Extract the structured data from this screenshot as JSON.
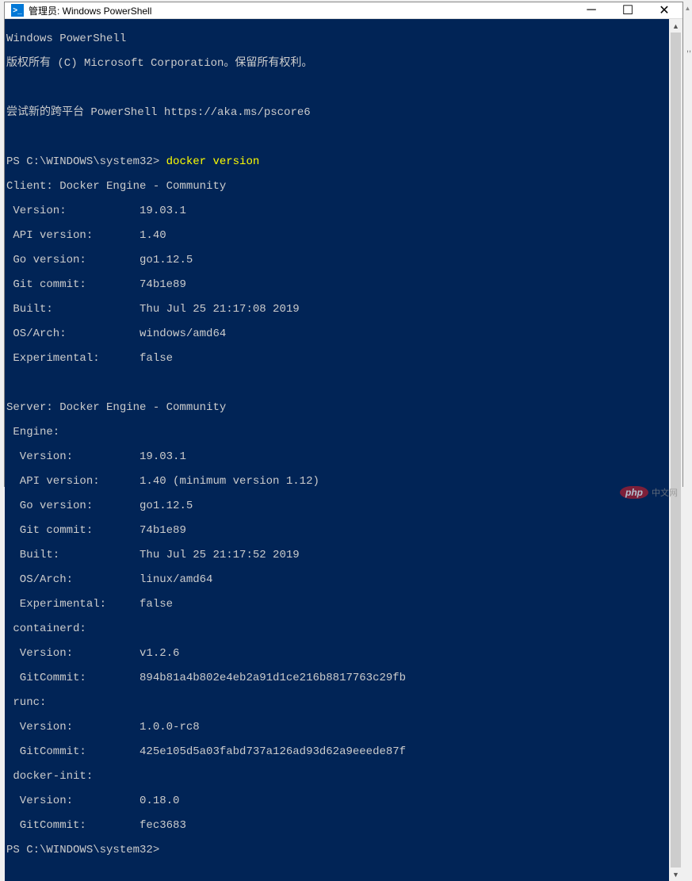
{
  "window": {
    "title": "管理员: Windows PowerShell",
    "icon_glyph": ">_"
  },
  "controls": {
    "minimize": "─",
    "maximize": "☐",
    "close": "✕"
  },
  "scrollbar": {
    "up": "▲",
    "down": "▼"
  },
  "header": {
    "line1": "Windows PowerShell",
    "line2": "版权所有 (C) Microsoft Corporation。保留所有权利。",
    "line3": "尝试新的跨平台 PowerShell https://aka.ms/pscore6"
  },
  "prompt1": {
    "prefix": "PS C:\\WINDOWS\\system32> ",
    "command": "docker version"
  },
  "output": {
    "client_header": "Client: Docker Engine - Community",
    "client": {
      "version_label": " Version:           ",
      "version_val": "19.03.1",
      "api_label": " API version:       ",
      "api_val": "1.40",
      "go_label": " Go version:        ",
      "go_val": "go1.12.5",
      "git_label": " Git commit:        ",
      "git_val": "74b1e89",
      "built_label": " Built:             ",
      "built_val": "Thu Jul 25 21:17:08 2019",
      "os_label": " OS/Arch:           ",
      "os_val": "windows/amd64",
      "exp_label": " Experimental:      ",
      "exp_val": "false"
    },
    "server_header": "Server: Docker Engine - Community",
    "engine_header": " Engine:",
    "engine": {
      "version_label": "  Version:          ",
      "version_val": "19.03.1",
      "api_label": "  API version:      ",
      "api_val": "1.40 (minimum version 1.12)",
      "go_label": "  Go version:       ",
      "go_val": "go1.12.5",
      "git_label": "  Git commit:       ",
      "git_val": "74b1e89",
      "built_label": "  Built:            ",
      "built_val": "Thu Jul 25 21:17:52 2019",
      "os_label": "  OS/Arch:          ",
      "os_val": "linux/amd64",
      "exp_label": "  Experimental:     ",
      "exp_val": "false"
    },
    "containerd_header": " containerd:",
    "containerd": {
      "version_label": "  Version:          ",
      "version_val": "v1.2.6",
      "git_label": "  GitCommit:        ",
      "git_val": "894b81a4b802e4eb2a91d1ce216b8817763c29fb"
    },
    "runc_header": " runc:",
    "runc": {
      "version_label": "  Version:          ",
      "version_val": "1.0.0-rc8",
      "git_label": "  GitCommit:        ",
      "git_val": "425e105d5a03fabd737a126ad93d62a9eeede87f"
    },
    "dockerinit_header": " docker-init:",
    "dockerinit": {
      "version_label": "  Version:          ",
      "version_val": "0.18.0",
      "git_label": "  GitCommit:        ",
      "git_val": "fec3683"
    }
  },
  "prompt2": "PS C:\\WINDOWS\\system32>",
  "watermark": {
    "badge": "php",
    "text": "中文网"
  }
}
